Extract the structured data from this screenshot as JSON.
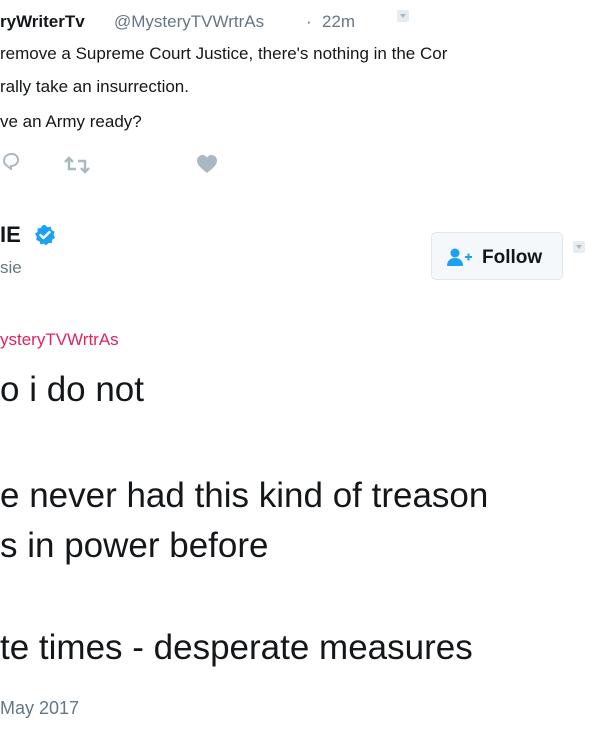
{
  "parent_tweet": {
    "display_name": "ryWriterTv",
    "handle": "@MysteryTVWrtrAs",
    "separator": "·",
    "time": "22m",
    "lines": [
      "remove a Supreme Court Justice, there's nothing in the Cor",
      "rally take an insurrection.",
      "ve an Army ready?"
    ],
    "icons": [
      "reply-icon",
      "retweet-icon",
      "like-icon",
      "caret-down-icon"
    ]
  },
  "reply_tweet": {
    "display_name": "IE",
    "handle": "sie",
    "verified": true,
    "follow_label": "Follow",
    "replying_to": "ysteryTVWrtrAs",
    "lines": [
      "o i do not",
      "e never had this kind of treason",
      "s in power before",
      "te times - desperate measures"
    ],
    "date": "May 2017"
  },
  "colors": {
    "text": "#14171a",
    "secondary": "#657786",
    "mention": "#e0245e",
    "verified_blue": "#1da1f2",
    "icon_gray": "#aab8c2",
    "button_bg": "#f5f8fa",
    "button_border": "#e1e8ed"
  }
}
